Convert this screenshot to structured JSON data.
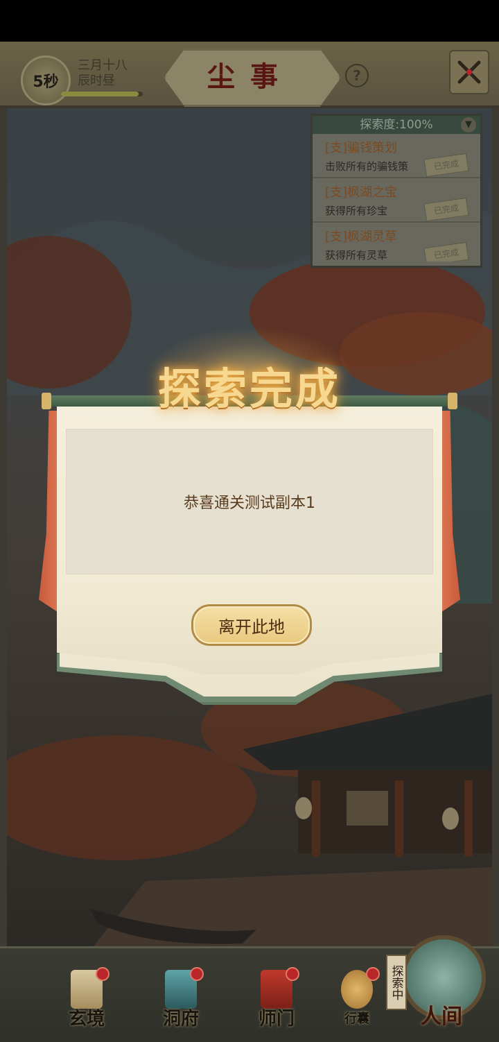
{
  "header": {
    "timer": "5秒",
    "date_line1": "三月十八",
    "date_line2": "辰时昼",
    "time_progress": 0.95,
    "title": "尘事",
    "help_label": "?"
  },
  "quest_panel": {
    "header": "探索度:100%",
    "items": [
      {
        "title": "[支]骗钱策划",
        "desc": "击败所有的骗钱策",
        "status": "已完成"
      },
      {
        "title": "[支]枫湖之宝",
        "desc": "获得所有珍宝",
        "status": "已完成"
      },
      {
        "title": "[支]枫湖灵草",
        "desc": "获得所有灵草",
        "status": "已完成"
      }
    ]
  },
  "modal": {
    "title": "探索完成",
    "message": "恭喜通关测试副本1",
    "leave_button": "离开此地"
  },
  "nav": {
    "items": [
      {
        "label": "玄境",
        "icon": "scroll-icon",
        "badge": true
      },
      {
        "label": "洞府",
        "icon": "lantern-icon",
        "badge": true
      },
      {
        "label": "师门",
        "icon": "banner-icon",
        "badge": true
      },
      {
        "label": "行囊",
        "icon": "bag-icon",
        "badge": true
      }
    ],
    "world_tag": "探索中",
    "world_label": "人间"
  },
  "colors": {
    "accent_red": "#b9262a",
    "gold": "#e9c97f",
    "title_red": "#5a1612"
  }
}
